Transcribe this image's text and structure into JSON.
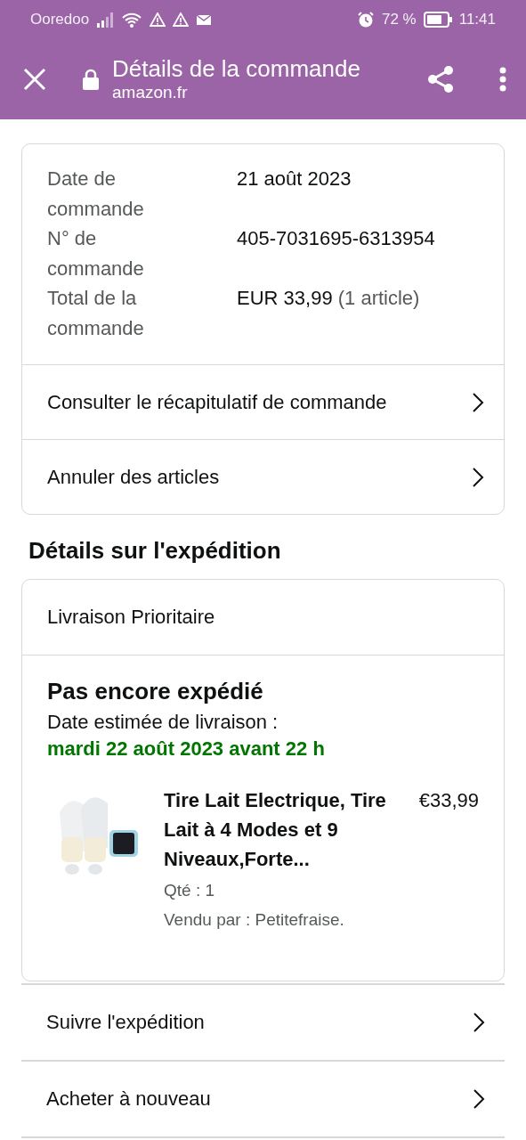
{
  "status_bar": {
    "carrier": "Ooredoo",
    "battery": "72 %",
    "time": "11:41"
  },
  "header": {
    "title": "Détails de la commande",
    "url": "amazon.fr"
  },
  "order_summary": {
    "fields": [
      {
        "label": "Date de commande",
        "value": "21 août 2023"
      },
      {
        "label": "N° de commande",
        "value": "405-7031695-6313954"
      },
      {
        "label": "Total de la commande",
        "value": "EUR 33,99",
        "note": "(1 article)"
      }
    ],
    "links": [
      "Consulter le récapitulatif de commande",
      "Annuler des articles"
    ]
  },
  "shipment": {
    "heading": "Détails sur l'expédition",
    "method": "Livraison Prioritaire",
    "status": "Pas encore expédié",
    "eta_label": "Date estimée de livraison :",
    "eta": "mardi 22 août 2023 avant 22 h",
    "item": {
      "kind": "picture",
      "title": "Tire Lait Electrique, Tire Lait à 4 Modes et 9 Niveaux,Forte...",
      "price": "€33,99",
      "quantity": "Qté : 1",
      "seller": "Vendu par : Petitefraise."
    }
  },
  "actions": [
    "Suivre l'expédition",
    "Acheter à nouveau"
  ]
}
